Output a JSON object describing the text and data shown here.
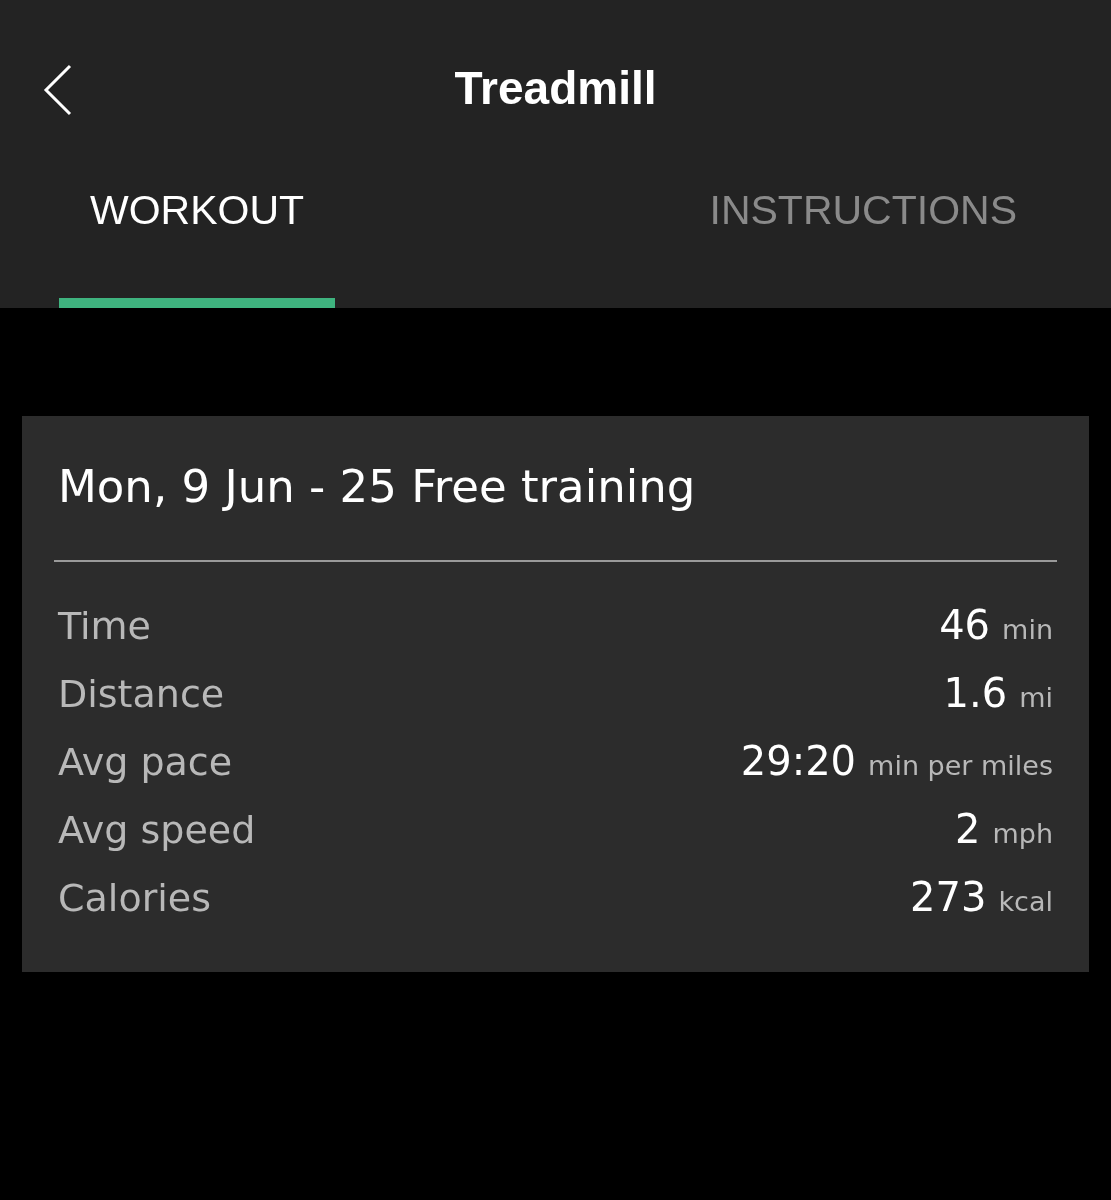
{
  "header": {
    "title": "Treadmill"
  },
  "tabs": [
    {
      "label": "WORKOUT",
      "selected": true
    },
    {
      "label": "INSTRUCTIONS",
      "selected": false
    }
  ],
  "card": {
    "title": "Mon, 9 Jun - 25 Free training",
    "stats": [
      {
        "label": "Time",
        "value": "46",
        "unit": "min"
      },
      {
        "label": "Distance",
        "value": "1.6",
        "unit": "mi"
      },
      {
        "label": "Avg pace",
        "value": "29:20",
        "unit": "min per miles"
      },
      {
        "label": "Avg speed",
        "value": "2",
        "unit": "mph"
      },
      {
        "label": "Calories",
        "value": "273",
        "unit": "kcal"
      }
    ]
  }
}
